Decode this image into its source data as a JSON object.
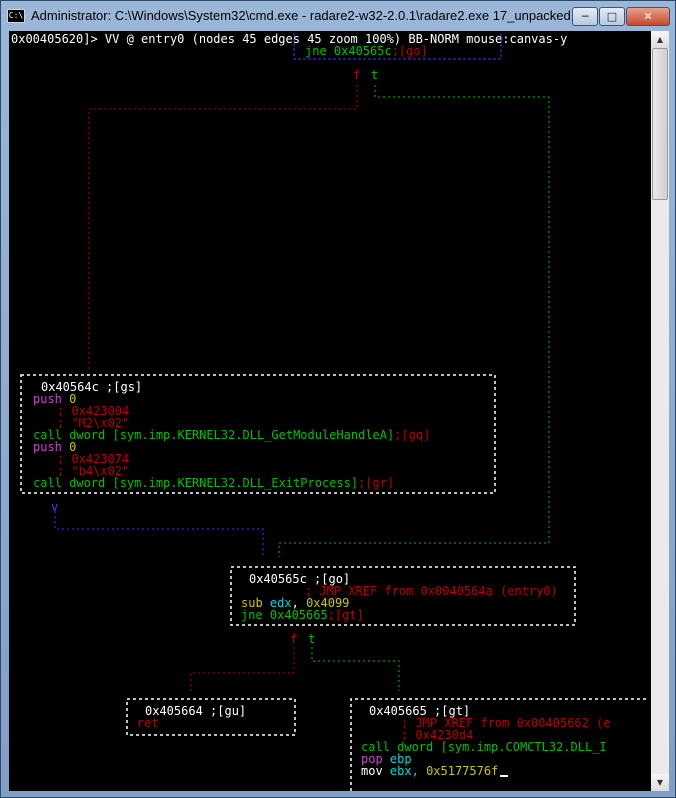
{
  "window": {
    "title": "Administrator: C:\\Windows\\System32\\cmd.exe - radare2-w32-2.0.1\\radare2.exe 17_unpacked.exe",
    "icon_glyph": "C:\\",
    "minimize_glyph": "─",
    "maximize_glyph": "□",
    "close_glyph": "✕"
  },
  "status": "0x00405620]> VV @ entry0 (nodes 45 edges 45 zoom 100%) BB-NORM mouse:canvas-y",
  "top": {
    "jne": "jne 0x40565c",
    "jne_ref": ";[go]",
    "f": "f",
    "t": "t"
  },
  "node_gs": {
    "header": "0x40564c ;[gs]",
    "lines": {
      "push1_op": "push",
      "push1_arg": "0",
      "c1": "; 0x423004",
      "c2": "; \"M2\\x02\"",
      "call1_a": "call dword [sym.imp.KERNEL32.DLL_GetModuleHandleA]",
      "call1_b": ";[gq]",
      "push2_op": "push",
      "push2_arg": "0",
      "c3": "; 0x423074",
      "c4": "; \"b4\\x02\"",
      "call2_a": "call dword [sym.imp.KERNEL32.DLL_ExitProcess]",
      "call2_b": ";[gr]"
    },
    "v": "v"
  },
  "node_go": {
    "header": "0x40565c ;[go]",
    "xref": "; JMP XREF from 0x0040564a (entry0)",
    "sub_op": "sub",
    "sub_reg": "edx",
    "sub_val": "0x4099",
    "jne": "jne 0x405665",
    "jne_ref": ";[gt]",
    "f": "f",
    "t": "t"
  },
  "node_gu": {
    "header": "0x405664 ;[gu]",
    "ret": "ret"
  },
  "node_gt": {
    "header": "0x405665 ;[gt]",
    "xref": "; JMP XREF from 0x00405662 (e",
    "c1": "; 0x4230d4",
    "call": "call dword [sym.imp.COMCTL32.DLL_I",
    "pop_op": "pop",
    "pop_reg": "ebp",
    "mov_op": "mov",
    "mov_reg": "ebx,",
    "mov_val": "0x5177576f"
  },
  "colors": {
    "true_edge": "#00c000",
    "false_edge": "#b80000",
    "uncond_edge": "#3a3aff",
    "node_border": "#ffffff"
  }
}
